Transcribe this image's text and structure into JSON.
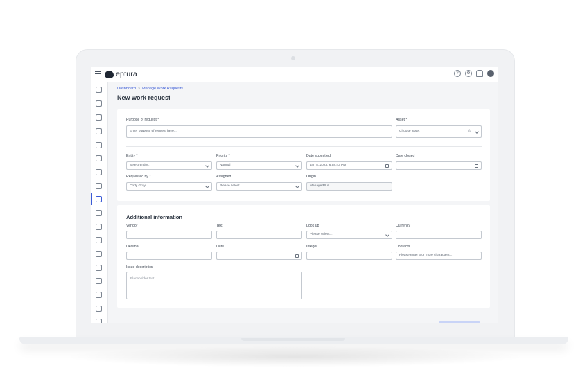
{
  "app": {
    "logo_text": "eptura"
  },
  "topbar": {
    "icons": [
      "help-icon",
      "gear-icon",
      "bell-icon",
      "user-avatar"
    ]
  },
  "sidebar": {
    "icons": [
      "dashboard-icon",
      "buildings-icon",
      "person-icon",
      "vehicle-icon",
      "document-icon",
      "clipboard-icon",
      "send-icon",
      "truck-icon",
      "wrench-icon",
      "cart-icon",
      "truck-cart-icon",
      "delivery-icon",
      "tools-icon",
      "worker-icon",
      "people-icon",
      "report-icon",
      "chart-icon",
      "settings-icon"
    ],
    "active_index": 8
  },
  "breadcrumb": {
    "home": "Dashboard",
    "separator": ">",
    "current": "Manage Work Requests"
  },
  "page": {
    "title": "New work request"
  },
  "form": {
    "purpose": {
      "label": "Purpose of request *",
      "placeholder": "Enter purpose of request here..."
    },
    "asset": {
      "label": "Asset *",
      "value": "Choose asset"
    },
    "entity": {
      "label": "Entity *",
      "value": "Select entity..."
    },
    "priority": {
      "label": "Priority *",
      "value": "Normal"
    },
    "date_submitted": {
      "label": "Date submitted",
      "value": "Jan 5, 2023, 6:58:43 PM"
    },
    "date_closed": {
      "label": "Date closed",
      "value": ""
    },
    "requested_by": {
      "label": "Requested by *",
      "value": "Cody Gray"
    },
    "assigned": {
      "label": "Assigned",
      "value": "Please select..."
    },
    "origin": {
      "label": "Origin",
      "value": "ManagerPlus"
    }
  },
  "additional": {
    "title": "Additional information",
    "vendor": {
      "label": "Vendor",
      "value": ""
    },
    "text": {
      "label": "Text",
      "value": ""
    },
    "lookup": {
      "label": "Look up",
      "value": "Please select..."
    },
    "currency": {
      "label": "Currency",
      "value": ""
    },
    "decimal": {
      "label": "Decimal",
      "value": ""
    },
    "date": {
      "label": "Date",
      "value": ""
    },
    "integer": {
      "label": "Integer",
      "value": ""
    },
    "contacts": {
      "label": "Contacts",
      "placeholder": "Please enter 3 or more characters..."
    },
    "issue": {
      "label": "Issue description",
      "placeholder": "Placeholder text"
    }
  }
}
